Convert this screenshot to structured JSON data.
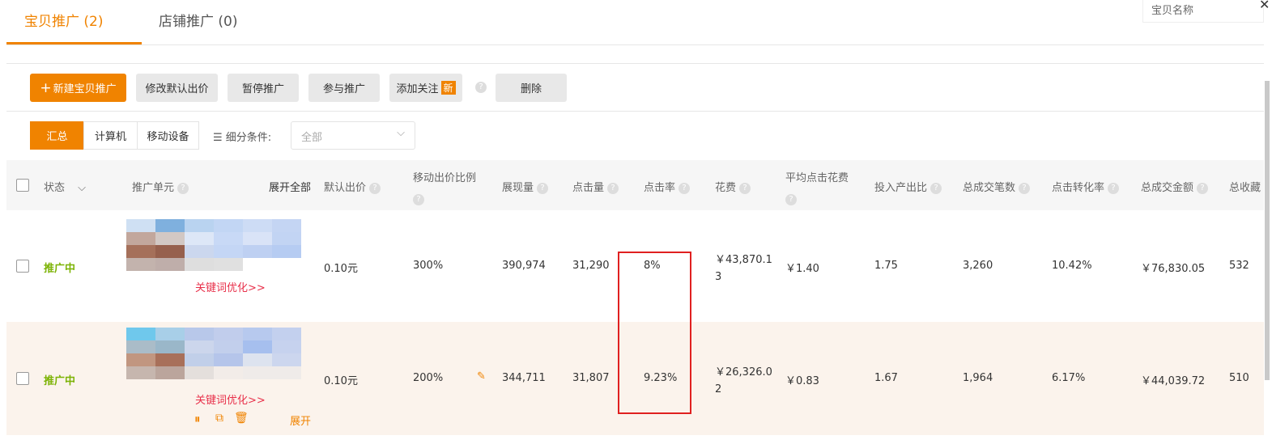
{
  "tabs": [
    {
      "label": "宝贝推广",
      "count": "(2)"
    },
    {
      "label": "店铺推广",
      "count": "(0)"
    }
  ],
  "search": {
    "placeholder": "宝贝名称"
  },
  "close": "✕",
  "toolbar": {
    "new": "新建宝贝推广",
    "modify_bid": "修改默认出价",
    "pause": "暂停推广",
    "join": "参与推广",
    "follow": "添加关注",
    "new_badge": "新",
    "delete": "删除"
  },
  "segments": [
    "汇总",
    "计算机",
    "移动设备"
  ],
  "filter": {
    "label": "细分条件:",
    "value": "全部"
  },
  "headers": {
    "status": "状态",
    "unit": "推广单元",
    "expand_all": "展开全部",
    "default_bid": "默认出价",
    "mobile_ratio": "移动出价比例",
    "impressions": "展现量",
    "clicks": "点击量",
    "ctr": "点击率",
    "cost": "花费",
    "avg_cpc": "平均点击花费",
    "roi": "投入产出比",
    "orders": "总成交笔数",
    "cvr": "点击转化率",
    "gmv": "总成交金额",
    "fav": "总收藏"
  },
  "rows": [
    {
      "status": "推广中",
      "keyword_link": "关键词优化>>",
      "default_bid": "0.10元",
      "mobile_ratio": "300%",
      "impressions": "390,974",
      "clicks": "31,290",
      "ctr": "8%",
      "cost_l1": "￥43,870.1",
      "cost_l2": "3",
      "avg_cpc": "￥1.40",
      "roi": "1.75",
      "orders": "3,260",
      "cvr": "10.42%",
      "gmv": "￥76,830.05",
      "fav": "532"
    },
    {
      "status": "推广中",
      "keyword_link": "关键词优化>>",
      "default_bid": "0.10元",
      "mobile_ratio": "200%",
      "impressions": "344,711",
      "clicks": "31,807",
      "ctr": "9.23%",
      "cost_l1": "￥26,326.0",
      "cost_l2": "2",
      "avg_cpc": "￥0.83",
      "roi": "1.67",
      "orders": "1,964",
      "cvr": "6.17%",
      "gmv": "￥44,039.72",
      "fav": "510",
      "expand": "展开"
    }
  ]
}
